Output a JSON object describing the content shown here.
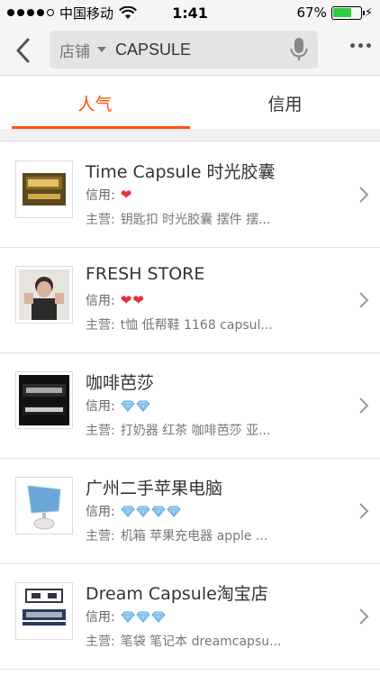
{
  "status_bar": {
    "carrier": "中国移动",
    "time": "1:41",
    "battery": "67%",
    "battery_level": 0.67,
    "wifi_icon": "wifi-icon",
    "charging_icon": "bolt-icon"
  },
  "header": {
    "search_scope": "店铺",
    "search_query": "CAPSULE",
    "back_icon": "back-chevron-icon",
    "mic_icon": "microphone-icon",
    "more_icon": "more-dots-icon"
  },
  "tabs": [
    {
      "label": "人气",
      "active": true
    },
    {
      "label": "信用",
      "active": false
    }
  ],
  "accent_color": "#ff5000",
  "shops": [
    {
      "name": "Time Capsule 时光胶囊",
      "credit_label": "信用:",
      "credit_type": "heart",
      "credit_count": 1,
      "main_label": "主营:",
      "main_items": "钥匙扣 时光胶囊 摆件 摆..."
    },
    {
      "name": "FRESH STORE",
      "credit_label": "信用:",
      "credit_type": "heart",
      "credit_count": 2,
      "main_label": "主营:",
      "main_items": "t恤 低帮鞋 1168 capsul..."
    },
    {
      "name": "咖啡芭莎",
      "credit_label": "信用:",
      "credit_type": "diamond",
      "credit_count": 2,
      "main_label": "主营:",
      "main_items": "打奶器 红茶 咖啡芭莎 亚..."
    },
    {
      "name": "广州二手苹果电脑",
      "credit_label": "信用:",
      "credit_type": "diamond",
      "credit_count": 4,
      "main_label": "主营:",
      "main_items": "机箱 苹果充电器 apple ..."
    },
    {
      "name": "Dream Capsule淘宝店",
      "credit_label": "信用:",
      "credit_type": "diamond",
      "credit_count": 3,
      "main_label": "主营:",
      "main_items": "笔袋 笔记本 dreamcapsu..."
    }
  ]
}
